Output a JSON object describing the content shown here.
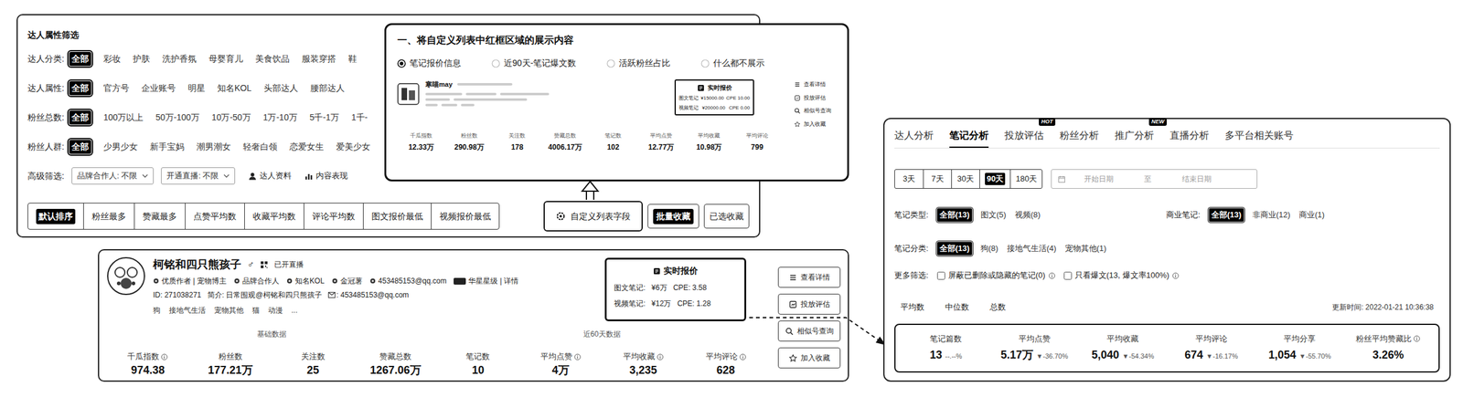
{
  "filter": {
    "title": "达人属性筛选",
    "rows": [
      {
        "label": "达人分类:",
        "options": [
          {
            "label": "全部",
            "selected": true
          },
          {
            "label": "彩妆",
            "selected": false
          },
          {
            "label": "护肤",
            "selected": false
          },
          {
            "label": "洗护香氛",
            "selected": false
          },
          {
            "label": "母婴育儿",
            "selected": false
          },
          {
            "label": "美食饮品",
            "selected": false
          },
          {
            "label": "服装穿搭",
            "selected": false
          },
          {
            "label": "鞋",
            "selected": false
          }
        ]
      },
      {
        "label": "达人属性:",
        "options": [
          {
            "label": "全部",
            "selected": true
          },
          {
            "label": "官方号",
            "selected": false
          },
          {
            "label": "企业账号",
            "selected": false
          },
          {
            "label": "明星",
            "selected": false
          },
          {
            "label": "知名KOL",
            "selected": false
          },
          {
            "label": "头部达人",
            "selected": false
          },
          {
            "label": "腰部达人",
            "selected": false
          }
        ]
      },
      {
        "label": "粉丝总数:",
        "options": [
          {
            "label": "全部",
            "selected": true
          },
          {
            "label": "100万以上",
            "selected": false
          },
          {
            "label": "50万-100万",
            "selected": false
          },
          {
            "label": "10万-50万",
            "selected": false
          },
          {
            "label": "1万-10万",
            "selected": false
          },
          {
            "label": "5千-1万",
            "selected": false
          },
          {
            "label": "1千-",
            "selected": false
          }
        ]
      },
      {
        "label": "粉丝人群:",
        "options": [
          {
            "label": "全部",
            "selected": true
          },
          {
            "label": "少男少女",
            "selected": false
          },
          {
            "label": "新手宝妈",
            "selected": false
          },
          {
            "label": "潮男潮女",
            "selected": false
          },
          {
            "label": "轻奢白领",
            "selected": false
          },
          {
            "label": "恋爱女生",
            "selected": false
          },
          {
            "label": "爱美少女",
            "selected": false
          }
        ]
      }
    ],
    "advanced": {
      "label": "高级筛选:",
      "dropdowns": [
        "品牌合作人: 不限",
        "开通直播: 不限"
      ],
      "links": [
        "达人资料",
        "内容表现"
      ]
    },
    "sort_tabs": [
      {
        "label": "默认排序",
        "selected": true
      },
      {
        "label": "粉丝最多",
        "selected": false
      },
      {
        "label": "赞藏最多",
        "selected": false
      },
      {
        "label": "点赞平均数",
        "selected": false
      },
      {
        "label": "收藏平均数",
        "selected": false
      },
      {
        "label": "评论平均数",
        "selected": false
      },
      {
        "label": "图文报价最低",
        "selected": false
      },
      {
        "label": "视频报价最低",
        "selected": false
      }
    ],
    "custom_button": "自定义列表字段",
    "actions": [
      {
        "label": "批量收藏",
        "selected": true
      },
      {
        "label": "已选收藏",
        "selected": false
      }
    ]
  },
  "overlay": {
    "title": "一、将自定义列表中红框区域的展示内容",
    "radios": [
      {
        "label": "笔记报价信息",
        "selected": true
      },
      {
        "label": "近90天-笔记爆文数",
        "selected": false
      },
      {
        "label": "活跃粉丝占比",
        "selected": false
      },
      {
        "label": "什么都不展示",
        "selected": false
      }
    ],
    "preview": {
      "name": "寒喵may",
      "quote": {
        "title": "实时报价",
        "rows": [
          {
            "label": "图文笔记",
            "price": "¥15000.00",
            "cpe": "CPE 10.00"
          },
          {
            "label": "视频笔记",
            "price": "¥20000.00",
            "cpe": "CPE 0.00"
          }
        ]
      },
      "actions": [
        "查看详情",
        "投放评估",
        "相似号查询",
        "加入收藏"
      ],
      "stats": [
        {
          "label": "千瓜指数",
          "value": "12.33万"
        },
        {
          "label": "粉丝数",
          "value": "290.98万"
        },
        {
          "label": "关注数",
          "value": "178"
        },
        {
          "label": "赞藏总数",
          "value": "4006.17万"
        },
        {
          "label": "笔记数",
          "value": "102"
        },
        {
          "label": "平均点赞",
          "value": "12.77万"
        },
        {
          "label": "平均收藏",
          "value": "10.98万"
        },
        {
          "label": "平均评论",
          "value": "799"
        }
      ]
    }
  },
  "creator": {
    "name": "柯铭和四只熊孩子",
    "gender": "♂",
    "live": "已开直播",
    "badges": [
      "优质作者 | 宠物博主",
      "品牌合作人",
      "知名KOL",
      "金冠薯",
      "453485153@qq.com",
      "华星星级 | 详情"
    ],
    "id": "ID: 271038271",
    "intro": "简介: 日常围观@柯铭和四只熊孩子",
    "email": ": 453485153@qq.com",
    "tags": [
      "狗",
      "接地气生活",
      "宠物其他",
      "猫",
      "动漫",
      "..."
    ],
    "quote": {
      "title": "实时报价",
      "rows": [
        {
          "label": "图文笔记:",
          "price": "¥6万",
          "cpe": "CPE: 3.58"
        },
        {
          "label": "视频笔记:",
          "price": "¥12万",
          "cpe": "CPE: 1.28"
        }
      ]
    },
    "sections": [
      "基础数据",
      "近60天数据"
    ],
    "stats": [
      {
        "label": "千瓜指数",
        "value": "974.38",
        "info": true
      },
      {
        "label": "粉丝数",
        "value": "177.21万",
        "info": false
      },
      {
        "label": "关注数",
        "value": "25",
        "info": false
      },
      {
        "label": "赞藏总数",
        "value": "1267.06万",
        "info": false
      },
      {
        "label": "笔记数",
        "value": "10",
        "info": false
      },
      {
        "label": "平均点赞",
        "value": "4万",
        "info": true
      },
      {
        "label": "平均收藏",
        "value": "3,235",
        "info": true
      },
      {
        "label": "平均评论",
        "value": "628",
        "info": true
      }
    ],
    "buttons": [
      "查看详情",
      "投放评估",
      "相似号查询",
      "加入收藏"
    ]
  },
  "analysis": {
    "tabs": [
      {
        "label": "达人分析",
        "selected": false
      },
      {
        "label": "笔记分析",
        "selected": true
      },
      {
        "label": "投放评估",
        "selected": false
      },
      {
        "label": "粉丝分析",
        "selected": false,
        "badge": "HOT"
      },
      {
        "label": "推广分析",
        "selected": false
      },
      {
        "label": "直播分析",
        "selected": false,
        "badge": "NEW"
      },
      {
        "label": "多平台相关账号",
        "selected": false
      }
    ],
    "periods": [
      {
        "label": "3天",
        "selected": false
      },
      {
        "label": "7天",
        "selected": false
      },
      {
        "label": "30天",
        "selected": false
      },
      {
        "label": "90天",
        "selected": true
      },
      {
        "label": "180天",
        "selected": false
      }
    ],
    "date_range": {
      "start": "开始日期",
      "sep": "至",
      "end": "结束日期"
    },
    "type_filter": {
      "label": "笔记类型:",
      "options": [
        {
          "label": "全部(13)",
          "selected": true
        },
        {
          "label": "图文(5)",
          "selected": false
        },
        {
          "label": "视频(8)",
          "selected": false
        }
      ]
    },
    "commercial_filter": {
      "label": "商业笔记:",
      "options": [
        {
          "label": "全部(13)",
          "selected": true
        },
        {
          "label": "非商业(12)",
          "selected": false
        },
        {
          "label": "商业(1)",
          "selected": false
        }
      ]
    },
    "category_filter": {
      "label": "笔记分类:",
      "options": [
        {
          "label": "全部(13)",
          "selected": true
        },
        {
          "label": "狗(8)",
          "selected": false
        },
        {
          "label": "接地气生活(4)",
          "selected": false
        },
        {
          "label": "宠物其他(1)",
          "selected": false
        }
      ]
    },
    "more": {
      "label": "更多筛选:",
      "checks": [
        {
          "label": "屏蔽已删除或隐藏的笔记(0)",
          "checked": false
        },
        {
          "label": "只看爆文(13, 爆文率100%)",
          "checked": false
        }
      ]
    },
    "stat_tabs": [
      "平均数",
      "中位数",
      "总数"
    ],
    "updated": "更新时间: 2022-01-21 10:36:38",
    "stats": [
      {
        "label": "笔记篇数",
        "value": "13",
        "change": "--.--%",
        "info": false
      },
      {
        "label": "平均点赞",
        "value": "5.17万",
        "change": "▼-36.70%",
        "info": false
      },
      {
        "label": "平均收藏",
        "value": "5,040",
        "change": "▼-54.34%",
        "info": false
      },
      {
        "label": "平均评论",
        "value": "674",
        "change": "▼-16.17%",
        "info": false
      },
      {
        "label": "平均分享",
        "value": "1,054",
        "change": "▼-55.70%",
        "info": false
      },
      {
        "label": "粉丝平均赞藏比",
        "value": "3.26%",
        "info": true
      }
    ]
  }
}
